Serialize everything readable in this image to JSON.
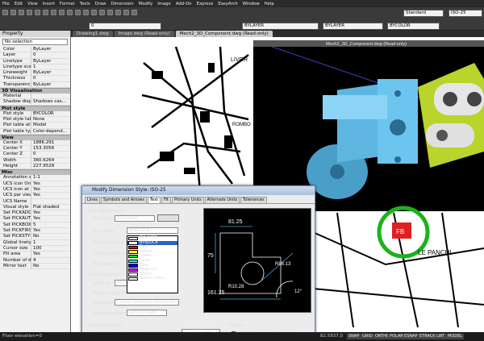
{
  "menu": [
    "File",
    "Edit",
    "View",
    "Insert",
    "Format",
    "Tools",
    "Draw",
    "Dimension",
    "Modify",
    "Image",
    "Add-On",
    "Express",
    "EasyArch",
    "Window",
    "Help"
  ],
  "toolbar": {
    "style": "Standard",
    "dimstyle": "ISO-25",
    "layer": "0",
    "lt1": "BYLAYER",
    "lt2": "BYLAYER",
    "color": "BYCOLOR"
  },
  "properties": {
    "title": "Property",
    "selection": "No selection",
    "cat_general_rows": [
      [
        "Color",
        "ByLayer"
      ],
      [
        "Layer",
        "0"
      ],
      [
        "Linetype",
        "ByLayer"
      ],
      [
        "Linetype scale",
        "1"
      ],
      [
        "Lineweight",
        "ByLayer"
      ],
      [
        "Thickness",
        "0"
      ],
      [
        "Transparency",
        "ByLayer"
      ]
    ],
    "cat3d": "3D Visualisation",
    "cat3d_rows": [
      [
        "Material",
        ""
      ],
      [
        "Shadow displ...",
        "Shadows cas..."
      ]
    ],
    "catplot": "Plot style",
    "catplot_rows": [
      [
        "Plot style",
        "BYCOLOR"
      ],
      [
        "Plot style table",
        "None"
      ],
      [
        "Plot table att...",
        "Model"
      ],
      [
        "Plot table type",
        "Color-depend..."
      ]
    ],
    "catview": "View",
    "catview_rows": [
      [
        "Center X",
        "1886.291"
      ],
      [
        "Center Y",
        "153.3056"
      ],
      [
        "Center Z",
        "0"
      ],
      [
        "Width",
        "360.6264"
      ],
      [
        "Height",
        "227.9528"
      ]
    ],
    "catmisc": "Misc",
    "catmisc_rows": [
      [
        "Annotation s...",
        "1:1"
      ],
      [
        "UCS icon On",
        "Yes"
      ],
      [
        "UCS icon at ...",
        "Yes"
      ],
      [
        "UCS per viewp...",
        "Yes"
      ],
      [
        "UCS Name",
        ""
      ],
      [
        "Visual style",
        "Flat shaded"
      ],
      [
        "Set PICKADD",
        "Yes"
      ],
      [
        "Set PICKAUTO",
        "Yes"
      ],
      [
        "Set PICKBOX",
        "5"
      ],
      [
        "Set PICKFIRST",
        "Yes"
      ],
      [
        "Set PICKSTYLE",
        "No"
      ],
      [
        "Global linetyp...",
        "1"
      ],
      [
        "Cursor size",
        "100"
      ],
      [
        "Fill area",
        "Yes"
      ],
      [
        "Number of de...",
        "4"
      ],
      [
        "Mirror text",
        "No"
      ]
    ]
  },
  "tabs": [
    "Drawing1.dwg",
    "Image.dwg (Read-only)",
    "Mech2_3D_Component.dwg (Read-only)"
  ],
  "viewport_title": "Mech2_3D_Component.dwg (Read-only)",
  "map_labels": {
    "livorno": "LIVOR",
    "le_panchi": "LE PANCHI",
    "fb": "FB",
    "rombo": "ROMBO"
  },
  "dialog": {
    "title": "Modify Dimension Style: ISO-25",
    "tabs": [
      "Lines",
      "Symbols and Arrows",
      "Text",
      "Fit",
      "Primary Units",
      "Alternate Units",
      "Tolerances"
    ],
    "active_tab": "Text",
    "appearance": "Text Appearance",
    "text_style_label": "Text style:",
    "text_style": "Standard",
    "explorer_btn": "Explorer...",
    "text_color_label": "Text color:",
    "text_color": "BYBLOCK",
    "text_bg_label": "Text background:",
    "bg_color_label": "Background color:",
    "text_height_label": "Text height:",
    "placement": "Text Placement",
    "vertical_label": "Vertical:",
    "vertical_value": "Above",
    "horizontal_label": "Horizontal:",
    "horizontal_value": "Center between extension lines",
    "offset_label": "Vertical text offset:",
    "view_dir_label": "View direction:",
    "view_dir_value": "Left-to-Right",
    "orientation": "Text Orientation",
    "orient_label": "Orientation when text outside extension lines:",
    "orient_value": "Aligned with Line",
    "options": "Options",
    "frame_label": "Draw frame around text",
    "color_options": [
      {
        "name": "BYLAYER",
        "hex": "#ffffff"
      },
      {
        "name": "BYBLOCK",
        "hex": "#ffffff"
      },
      {
        "name": "Red",
        "hex": "#ff0000"
      },
      {
        "name": "Yellow",
        "hex": "#ffff00"
      },
      {
        "name": "Green",
        "hex": "#00ff00"
      },
      {
        "name": "Cyan",
        "hex": "#00ffff"
      },
      {
        "name": "Blue",
        "hex": "#0000ff"
      },
      {
        "name": "Magenta",
        "hex": "#ff00ff"
      },
      {
        "name": "White",
        "hex": "#ffffff"
      },
      {
        "name": "Select Color...",
        "hex": "#ffffff"
      }
    ],
    "preview_dims": {
      "d1": "81.25",
      "d2": "75",
      "d3": "R88.13",
      "d4": "161.25",
      "d5": "R10.28",
      "d6": "12°"
    }
  },
  "status": {
    "left": "Floor elevation=0",
    "coords": "82.5937,0",
    "buttons": [
      "SNAP",
      "GRID",
      "ORTHO",
      "POLAR",
      "ESNAP",
      "ETRACK",
      "LWT",
      "MODEL"
    ]
  }
}
